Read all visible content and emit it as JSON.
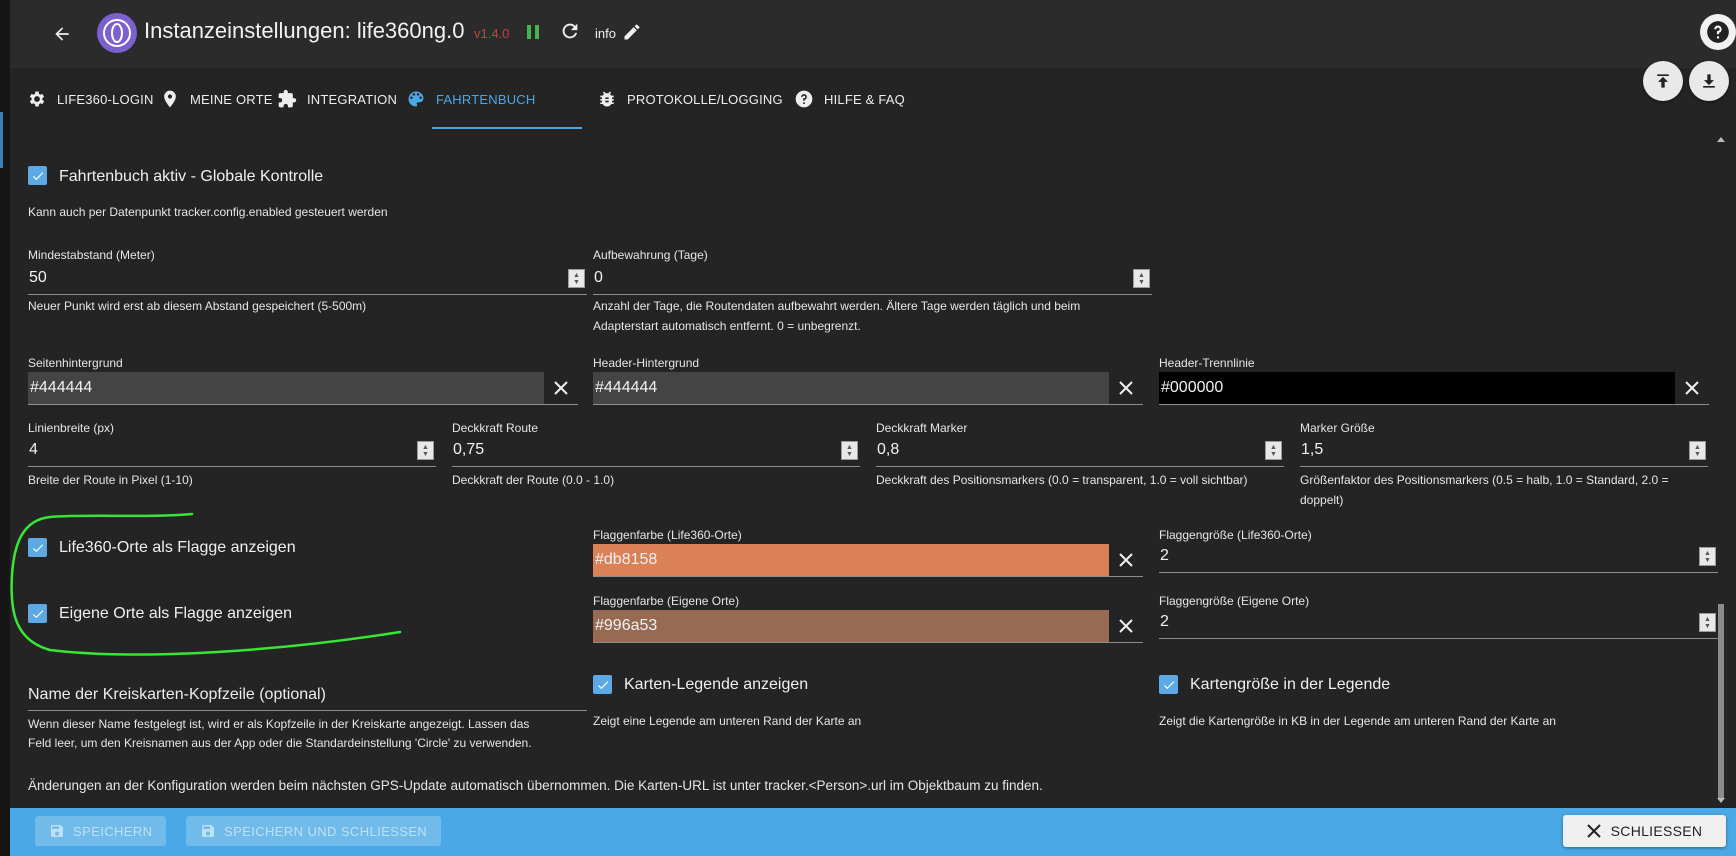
{
  "header": {
    "title": "Instanzeinstellungen:  life360ng.0",
    "version": "v1.4.0",
    "info_label": "info"
  },
  "tabs": [
    {
      "label": "LIFE360-LOGIN",
      "icon": "gear-icon"
    },
    {
      "label": "MEINE ORTE",
      "icon": "map-pin-icon"
    },
    {
      "label": "INTEGRATION",
      "icon": "puzzle-icon"
    },
    {
      "label": "FAHRTENBUCH",
      "icon": "palette-icon",
      "active": true
    },
    {
      "label": "PROTOKOLLE/LOGGING",
      "icon": "bug-icon"
    },
    {
      "label": "HILFE & FAQ",
      "icon": "help-circle-icon"
    }
  ],
  "form": {
    "enabled": {
      "label": "Fahrtenbuch aktiv - Globale Kontrolle",
      "checked": true,
      "help": "Kann auch per Datenpunkt tracker.config.enabled gesteuert werden"
    },
    "min_distance": {
      "label": "Mindestabstand (Meter)",
      "value": "50",
      "help": "Neuer Punkt wird erst ab diesem Abstand gespeichert (5-500m)"
    },
    "retention": {
      "label": "Aufbewahrung (Tage)",
      "value": "0",
      "help_line1": "Anzahl der Tage, die Routendaten aufbewahrt werden. Ältere Tage werden täglich und beim",
      "help_line2": "Adapterstart automatisch entfernt. 0 = unbegrenzt."
    },
    "page_bg": {
      "label": "Seitenhintergrund",
      "value": "#444444",
      "color": "#444444"
    },
    "header_bg": {
      "label": "Header-Hintergrund",
      "value": "#444444",
      "color": "#444444"
    },
    "header_line": {
      "label": "Header-Trennlinie",
      "value": "#000000",
      "color": "#000000"
    },
    "line_width": {
      "label": "Linienbreite (px)",
      "value": "4",
      "help": "Breite der Route in Pixel (1-10)"
    },
    "route_opacity": {
      "label": "Deckkraft Route",
      "value": "0,75",
      "help": "Deckkraft der Route (0.0 - 1.0)"
    },
    "marker_opacity": {
      "label": "Deckkraft Marker",
      "value": "0,8",
      "help": "Deckkraft des Positionsmarkers (0.0 = transparent, 1.0 = voll sichtbar)"
    },
    "marker_size": {
      "label": "Marker Größe",
      "value": "1,5",
      "help_line1": "Größenfaktor des Positionsmarkers (0.5 = halb, 1.0 = Standard, 2.0 =",
      "help_line2": "doppelt)"
    },
    "flag_life360": {
      "label": "Life360-Orte als Flagge anzeigen",
      "checked": true
    },
    "flag_own": {
      "label": "Eigene Orte als Flagge anzeigen",
      "checked": true
    },
    "flag_color_life360": {
      "label": "Flaggenfarbe (Life360-Orte)",
      "value": "#db8158",
      "color": "#db8158"
    },
    "flag_color_own": {
      "label": "Flaggenfarbe (Eigene Orte)",
      "value": "#996a53",
      "color": "#996a53"
    },
    "flag_size_life360": {
      "label": "Flaggengröße (Life360-Orte)",
      "value": "2"
    },
    "flag_size_own": {
      "label": "Flaggengröße (Eigene Orte)",
      "value": "2"
    },
    "circle_header": {
      "label": "Name der Kreiskarten-Kopfzeile (optional)",
      "help_line1": "Wenn dieser Name festgelegt ist, wird er als Kopfzeile in der Kreiskarte angezeigt. Lassen das",
      "help_line2": "Feld leer, um den Kreisnamen aus der App oder die Standardeinstellung 'Circle' zu verwenden."
    },
    "show_legend": {
      "label": "Karten-Legende anzeigen",
      "checked": true,
      "help": "Zeigt eine Legende am unteren Rand der Karte an"
    },
    "legend_size": {
      "label": "Kartengröße in der Legende",
      "checked": true,
      "help": "Zeigt die Kartengröße in KB in der Legende am unteren Rand der Karte an"
    },
    "footer_note": "Änderungen an der Konfiguration werden beim nächsten GPS-Update automatisch übernommen. Die Karten-URL ist unter tracker.<Person>.url im Objektbaum zu finden."
  },
  "footer": {
    "save": "SPEICHERN",
    "save_close": "SPEICHERN UND SCHLIESSEN",
    "close": "SCHLIESSEN"
  },
  "colors": {
    "accent": "#4aa8e6",
    "checkbox": "#5ca9e6",
    "annotation": "#39e636",
    "version": "#c0433d",
    "running": "#4caf50"
  }
}
